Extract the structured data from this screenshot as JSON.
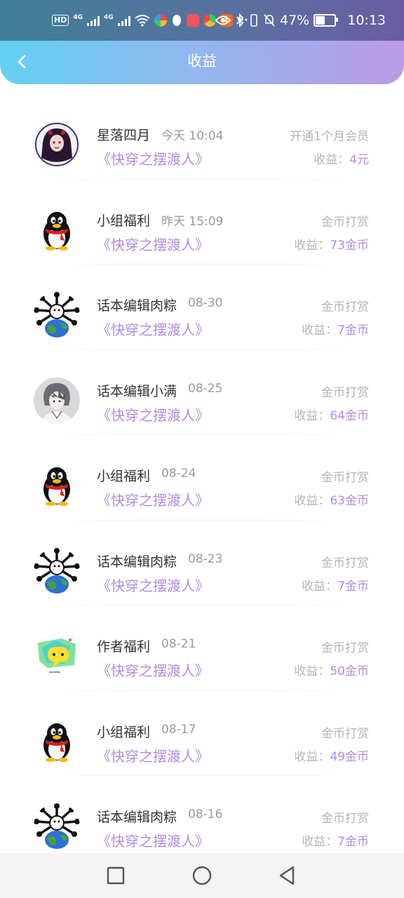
{
  "status_bar": {
    "hd": "HD",
    "net1": "4G",
    "net2": "4G",
    "dots": "···",
    "battery": "47%",
    "time": "10:13"
  },
  "header": {
    "title": "收益"
  },
  "records": [
    {
      "name": "星落四月",
      "date": "今天 10:04",
      "book": "《快穿之摆渡人》",
      "type": "开通1个月会员",
      "earn_label": "收益：",
      "amount": "4元",
      "avatar": "portrait"
    },
    {
      "name": "小组福利",
      "date": "昨天 15:09",
      "book": "《快穿之摆渡人》",
      "type": "金币打赏",
      "earn_label": "收益：",
      "amount": "73金币",
      "avatar": "penguin"
    },
    {
      "name": "话本编辑肉粽",
      "date": "08-30",
      "book": "《快穿之摆渡人》",
      "type": "金币打赏",
      "earn_label": "收益：",
      "amount": "7金币",
      "avatar": "earth"
    },
    {
      "name": "话本编辑小满",
      "date": "08-25",
      "book": "《快穿之摆渡人》",
      "type": "金币打赏",
      "earn_label": "收益：",
      "amount": "64金币",
      "avatar": "anime"
    },
    {
      "name": "小组福利",
      "date": "08-24",
      "book": "《快穿之摆渡人》",
      "type": "金币打赏",
      "earn_label": "收益：",
      "amount": "63金币",
      "avatar": "penguin"
    },
    {
      "name": "话本编辑肉粽",
      "date": "08-23",
      "book": "《快穿之摆渡人》",
      "type": "金币打赏",
      "earn_label": "收益：",
      "amount": "7金币",
      "avatar": "earth"
    },
    {
      "name": "作者福利",
      "date": "08-21",
      "book": "《快穿之摆渡人》",
      "type": "金币打赏",
      "earn_label": "收益：",
      "amount": "50金币",
      "avatar": "chat"
    },
    {
      "name": "小组福利",
      "date": "08-17",
      "book": "《快穿之摆渡人》",
      "type": "金币打赏",
      "earn_label": "收益：",
      "amount": "49金币",
      "avatar": "penguin"
    },
    {
      "name": "话本编辑肉粽",
      "date": "08-16",
      "book": "《快穿之摆渡人》",
      "type": "金币打赏",
      "earn_label": "收益：",
      "amount": "7金币",
      "avatar": "earth"
    }
  ],
  "nav": {
    "icons": [
      "recent-apps-icon",
      "home-icon",
      "back-icon"
    ]
  }
}
